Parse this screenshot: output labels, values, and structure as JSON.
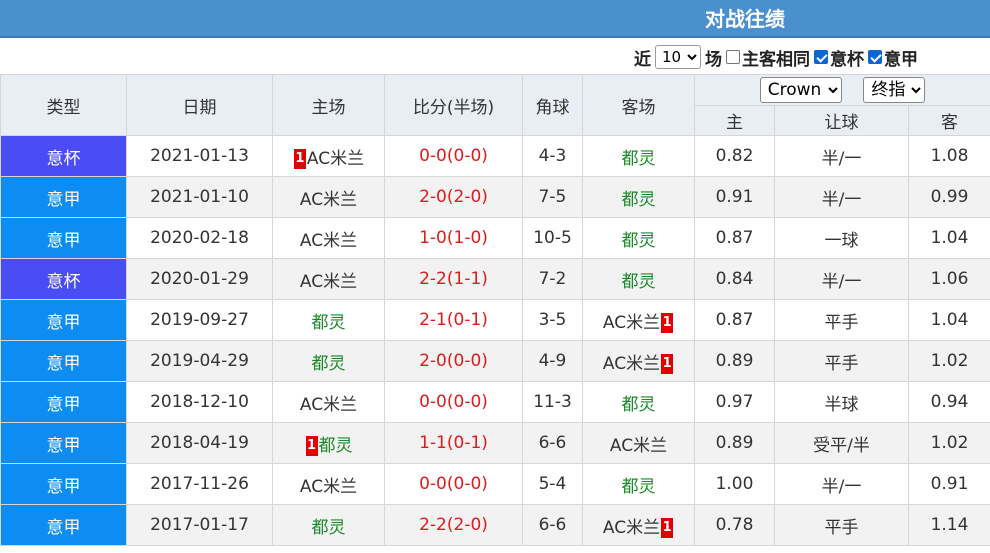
{
  "header": {
    "title": "对战往绩"
  },
  "filters": {
    "recent_label": "近",
    "count_value": "10",
    "count_suffix": "场",
    "same_home_away": {
      "label": "主客相同",
      "checked": false
    },
    "cup": {
      "label": "意杯",
      "checked": true
    },
    "league": {
      "label": "意甲",
      "checked": true
    }
  },
  "table": {
    "columns": {
      "type": "类型",
      "date": "日期",
      "home": "主场",
      "score": "比分(半场)",
      "corners": "角球",
      "away": "客场"
    },
    "odds_company": "Crown",
    "odds_kind": "终指",
    "odds_columns": {
      "home": "主",
      "handicap": "让球",
      "away": "客"
    },
    "colors": {
      "cup": "#4a4cf4",
      "league": "#0d8cf2",
      "score": "#e01b1b",
      "team_green": "#1d8a2a",
      "red_card": "#e40000"
    },
    "rows": [
      {
        "type": "意杯",
        "type_kind": "cup",
        "date": "2021-01-13",
        "home": "AC米兰",
        "home_green": false,
        "home_badge": "1",
        "score": "0-0",
        "half": "(0-0)",
        "corners": "4-3",
        "away": "都灵",
        "away_green": true,
        "away_badge": "",
        "odds_home": "0.82",
        "handicap": "半/一",
        "odds_away": "1.08"
      },
      {
        "type": "意甲",
        "type_kind": "league",
        "date": "2021-01-10",
        "home": "AC米兰",
        "home_green": false,
        "home_badge": "",
        "score": "2-0",
        "half": "(2-0)",
        "corners": "7-5",
        "away": "都灵",
        "away_green": true,
        "away_badge": "",
        "odds_home": "0.91",
        "handicap": "半/一",
        "odds_away": "0.99"
      },
      {
        "type": "意甲",
        "type_kind": "league",
        "date": "2020-02-18",
        "home": "AC米兰",
        "home_green": false,
        "home_badge": "",
        "score": "1-0",
        "half": "(1-0)",
        "corners": "10-5",
        "away": "都灵",
        "away_green": true,
        "away_badge": "",
        "odds_home": "0.87",
        "handicap": "一球",
        "odds_away": "1.04"
      },
      {
        "type": "意杯",
        "type_kind": "cup",
        "date": "2020-01-29",
        "home": "AC米兰",
        "home_green": false,
        "home_badge": "",
        "score": "2-2",
        "half": "(1-1)",
        "corners": "7-2",
        "away": "都灵",
        "away_green": true,
        "away_badge": "",
        "odds_home": "0.84",
        "handicap": "半/一",
        "odds_away": "1.06"
      },
      {
        "type": "意甲",
        "type_kind": "league",
        "date": "2019-09-27",
        "home": "都灵",
        "home_green": true,
        "home_badge": "",
        "score": "2-1",
        "half": "(0-1)",
        "corners": "3-5",
        "away": "AC米兰",
        "away_green": false,
        "away_badge": "1",
        "odds_home": "0.87",
        "handicap": "平手",
        "odds_away": "1.04"
      },
      {
        "type": "意甲",
        "type_kind": "league",
        "date": "2019-04-29",
        "home": "都灵",
        "home_green": true,
        "home_badge": "",
        "score": "2-0",
        "half": "(0-0)",
        "corners": "4-9",
        "away": "AC米兰",
        "away_green": false,
        "away_badge": "1",
        "odds_home": "0.89",
        "handicap": "平手",
        "odds_away": "1.02"
      },
      {
        "type": "意甲",
        "type_kind": "league",
        "date": "2018-12-10",
        "home": "AC米兰",
        "home_green": false,
        "home_badge": "",
        "score": "0-0",
        "half": "(0-0)",
        "corners": "11-3",
        "away": "都灵",
        "away_green": true,
        "away_badge": "",
        "odds_home": "0.97",
        "handicap": "半球",
        "odds_away": "0.94"
      },
      {
        "type": "意甲",
        "type_kind": "league",
        "date": "2018-04-19",
        "home": "都灵",
        "home_green": true,
        "home_badge": "1",
        "score": "1-1",
        "half": "(0-1)",
        "corners": "6-6",
        "away": "AC米兰",
        "away_green": false,
        "away_badge": "",
        "odds_home": "0.89",
        "handicap": "受平/半",
        "odds_away": "1.02"
      },
      {
        "type": "意甲",
        "type_kind": "league",
        "date": "2017-11-26",
        "home": "AC米兰",
        "home_green": false,
        "home_badge": "",
        "score": "0-0",
        "half": "(0-0)",
        "corners": "5-4",
        "away": "都灵",
        "away_green": true,
        "away_badge": "",
        "odds_home": "1.00",
        "handicap": "半/一",
        "odds_away": "0.91"
      },
      {
        "type": "意甲",
        "type_kind": "league",
        "date": "2017-01-17",
        "home": "都灵",
        "home_green": true,
        "home_badge": "",
        "score": "2-2",
        "half": "(2-0)",
        "corners": "6-6",
        "away": "AC米兰",
        "away_green": false,
        "away_badge": "1",
        "odds_home": "0.78",
        "handicap": "平手",
        "odds_away": "1.14"
      }
    ]
  }
}
